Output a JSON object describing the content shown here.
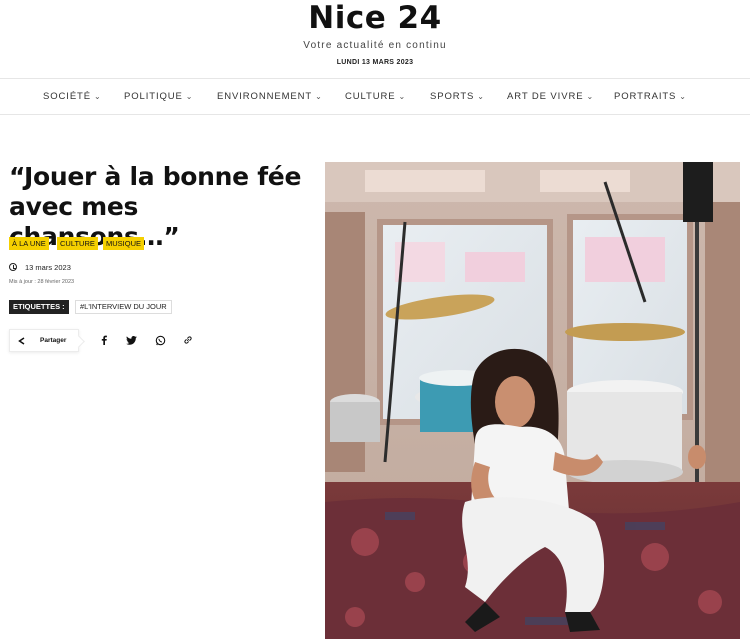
{
  "site": {
    "title": "Nice 24",
    "tagline": "Votre actualité en continu",
    "date": "LUNDI 13 MARS 2023"
  },
  "nav": {
    "items": [
      {
        "label": "SOCIÉTÉ",
        "chevron": "⌄"
      },
      {
        "label": "POLITIQUE",
        "chevron": "⌄"
      },
      {
        "label": "ENVIRONNEMENT",
        "chevron": "⌄"
      },
      {
        "label": "CULTURE",
        "chevron": "⌄"
      },
      {
        "label": "SPORTS",
        "chevron": "⌄"
      },
      {
        "label": "ART DE VIVRE",
        "chevron": "⌄"
      },
      {
        "label": "PORTRAITS",
        "chevron": "⌄"
      }
    ]
  },
  "article": {
    "title": "“Jouer à la bonne fée avec mes chansons…”",
    "categories": [
      "À LA UNE",
      "CULTURE",
      "MUSIQUE"
    ],
    "published": "13 mars 2023",
    "updated": "Mis à jour : 28 février 2023",
    "tags_label": "ETIQUETTES :",
    "tags": [
      "#L'INTERVIEW DU JOUR"
    ],
    "share_label": "Partager",
    "social_icons": [
      "facebook-icon",
      "twitter-icon",
      "whatsapp-icon",
      "copy-link-icon"
    ]
  },
  "colors": {
    "category_badge": "#f5d000",
    "tag_label_bg": "#222222",
    "text": "#111111"
  }
}
